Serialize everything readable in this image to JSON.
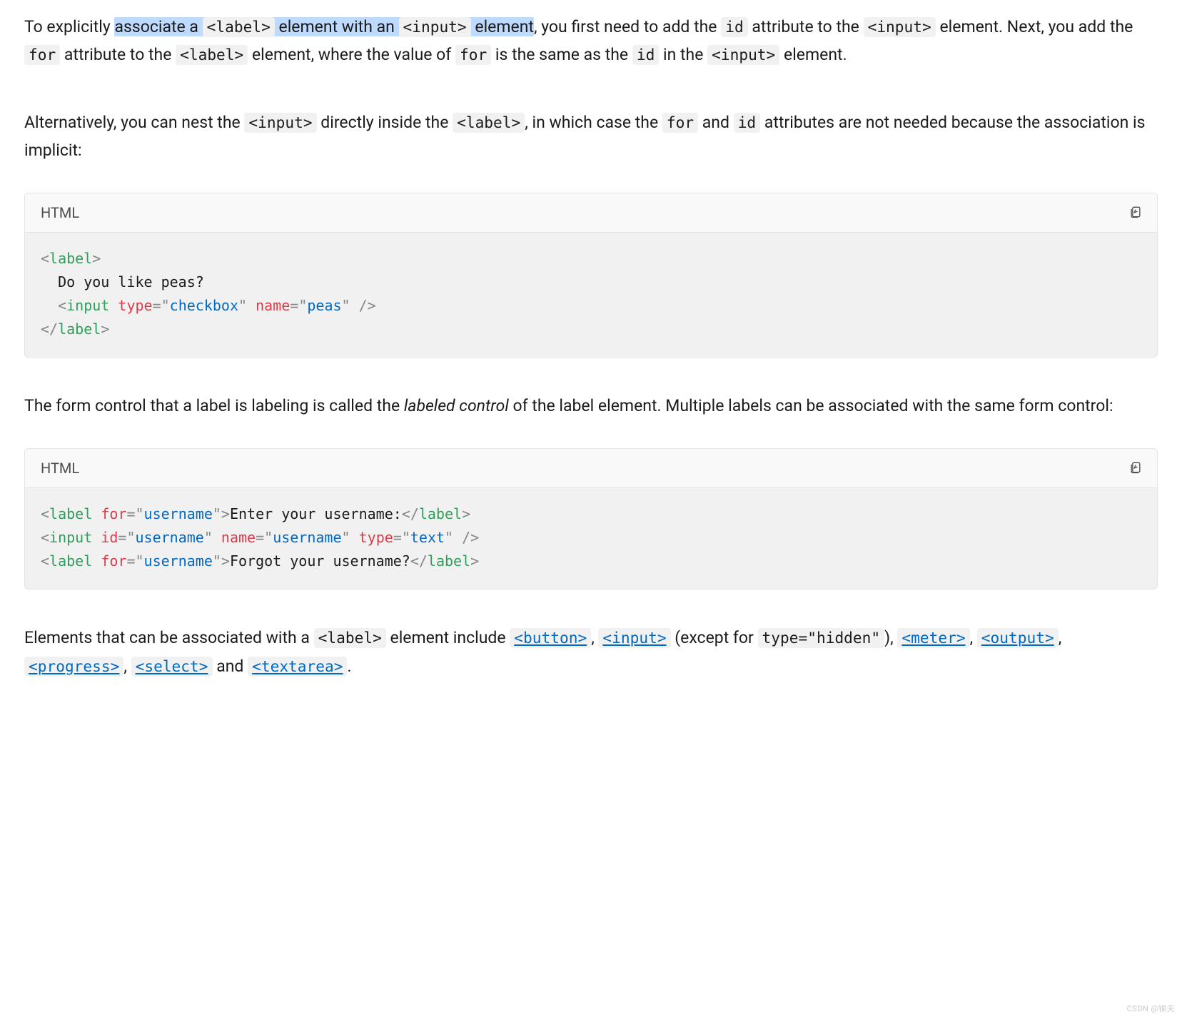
{
  "para1": {
    "t1": "To explicitly ",
    "hl1": "associate a ",
    "hl_code_label": "<label>",
    "hl2": " element with an ",
    "hl_code_input": "<input>",
    "hl3": " element",
    "t2": ", you first need to add the ",
    "code_id": "id",
    "t3": " attribute to the ",
    "code_input2": "<input>",
    "t4": " element. Next, you add the ",
    "code_for": "for",
    "t5": " attribute to the ",
    "code_label2": "<label>",
    "t6": " element, where the value of ",
    "code_for2": "for",
    "t7": " is the same as the ",
    "code_id2": "id",
    "t8": " in the ",
    "code_input3": "<input>",
    "t9": " element."
  },
  "para2": {
    "t1": "Alternatively, you can nest the ",
    "code_input": "<input>",
    "t2": " directly inside the ",
    "code_label": "<label>",
    "t3": ", in which case the ",
    "code_for": "for",
    "t4": " and ",
    "code_id": "id",
    "t5": " attributes are not needed because the association is implicit:"
  },
  "code1": {
    "lang_label": "HTML",
    "tokens": {
      "l1_open": "<",
      "l1_tag": "label",
      "l1_close": ">",
      "l2_text": "  Do you like peas?",
      "l3_open": "<",
      "l3_tag": "input",
      "l3_sp": " ",
      "l3_a1": "type",
      "l3_eq1": "=",
      "l3_q1a": "\"",
      "l3_v1": "checkbox",
      "l3_q1b": "\"",
      "l3_sp2": " ",
      "l3_a2": "name",
      "l3_eq2": "=",
      "l3_q2a": "\"",
      "l3_v2": "peas",
      "l3_q2b": "\"",
      "l3_close": " />",
      "l4_open": "</",
      "l4_tag": "label",
      "l4_close": ">"
    }
  },
  "para3": {
    "t1": "The form control that a label is labeling is called the ",
    "em": "labeled control",
    "t2": " of the label element. Multiple labels can be associated with the same form control:"
  },
  "code2": {
    "lang_label": "HTML",
    "tokens": {
      "l1_open": "<",
      "l1_tag": "label",
      "l1_sp": " ",
      "l1_a1": "for",
      "l1_eq": "=",
      "l1_qa": "\"",
      "l1_v": "username",
      "l1_qb": "\"",
      "l1_gt": ">",
      "l1_text": "Enter your username:",
      "l1_close_o": "</",
      "l1_close_t": "label",
      "l1_close_g": ">",
      "l2_open": "<",
      "l2_tag": "input",
      "l2_sp": " ",
      "l2_a1": "id",
      "l2_eq1": "=",
      "l2_q1a": "\"",
      "l2_v1": "username",
      "l2_q1b": "\"",
      "l2_sp2": " ",
      "l2_a2": "name",
      "l2_eq2": "=",
      "l2_q2a": "\"",
      "l2_v2": "username",
      "l2_q2b": "\"",
      "l2_sp3": " ",
      "l2_a3": "type",
      "l2_eq3": "=",
      "l2_q3a": "\"",
      "l2_v3": "text",
      "l2_q3b": "\"",
      "l2_close": " />",
      "l3_open": "<",
      "l3_tag": "label",
      "l3_sp": " ",
      "l3_a1": "for",
      "l3_eq": "=",
      "l3_qa": "\"",
      "l3_v": "username",
      "l3_qb": "\"",
      "l3_gt": ">",
      "l3_text": "Forgot your username?",
      "l3_close_o": "</",
      "l3_close_t": "label",
      "l3_close_g": ">"
    }
  },
  "para4": {
    "t1": "Elements that can be associated with a ",
    "code_label": "<label>",
    "t2": " element include ",
    "link_button": "<button>",
    "c1": ", ",
    "link_input": "<input>",
    "t3": " (except for ",
    "code_hidden": "type=\"hidden\"",
    "t4": "), ",
    "link_meter": "<meter>",
    "c2": ", ",
    "link_output": "<output>",
    "c3": ", ",
    "link_progress": "<progress>",
    "c4": ", ",
    "link_select": "<select>",
    "t5": " and ",
    "link_textarea": "<textarea>",
    "t6": "."
  },
  "watermark": "CSDN @锦天"
}
